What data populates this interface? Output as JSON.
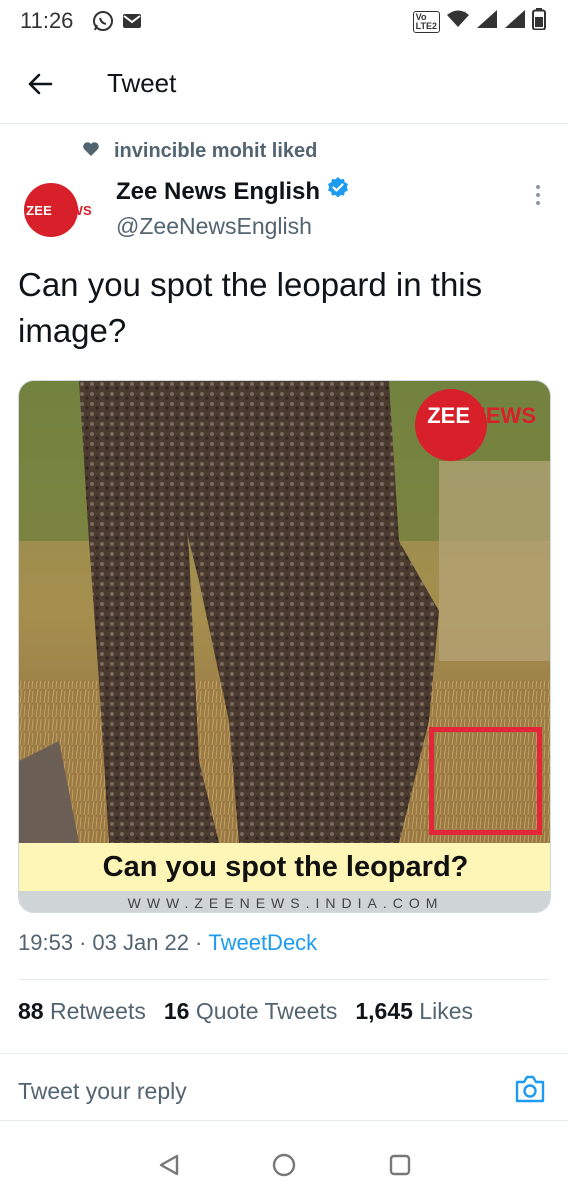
{
  "status": {
    "time": "11:26",
    "network_label": "VoLTE 2"
  },
  "header": {
    "title": "Tweet"
  },
  "social_context": {
    "text": "invincible mohit liked"
  },
  "tweet": {
    "author_name": "Zee News English",
    "author_handle": "@ZeeNewsEnglish",
    "avatar_text_zee": "ZEE",
    "avatar_text_news": "NEWS",
    "verified": true,
    "text": "Can you spot the leopard in this image?",
    "media": {
      "logo_zee": "ZEE",
      "logo_news": "NEWS",
      "caption": "Can you spot the leopard?",
      "footer": "WWW.ZEENEWS.INDIA.COM"
    },
    "time": "19:53",
    "date": "03 Jan 22",
    "source": "TweetDeck",
    "separator": "·"
  },
  "stats": {
    "retweets_count": "88",
    "retweets_label": "Retweets",
    "quotes_count": "16",
    "quotes_label": "Quote Tweets",
    "likes_count": "1,645",
    "likes_label": "Likes"
  },
  "reply": {
    "placeholder": "Tweet your reply"
  },
  "colors": {
    "accent": "#1d9bf0",
    "brand_red": "#d7202a",
    "highlight": "#e3263a"
  },
  "icons": [
    "whatsapp-icon",
    "message-icon",
    "wifi-icon",
    "signal-icon",
    "battery-icon",
    "back-arrow-icon",
    "heart-icon",
    "verified-icon",
    "more-vertical-icon",
    "camera-icon",
    "nav-back-icon",
    "nav-home-icon",
    "nav-recents-icon"
  ]
}
